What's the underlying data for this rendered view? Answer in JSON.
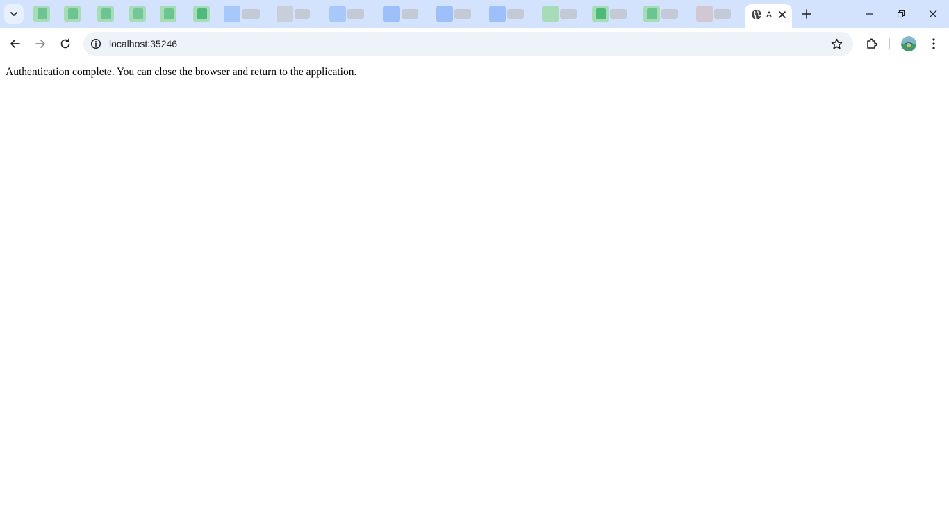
{
  "browser": {
    "active_tab": {
      "title": "A",
      "icon": "globe-icon"
    },
    "background_tabs_note_colors": {
      "green": "#6cc590",
      "blue": "#8ab4f8",
      "gray": "#b9bfca",
      "pink": "#d7c2cc"
    },
    "address_bar": {
      "url": "localhost:35246",
      "site_info_icon": "info-icon"
    },
    "icons": {
      "tab_search": "chevron-down-icon",
      "new_tab": "plus-icon",
      "minimize": "minimize-icon",
      "restore": "restore-icon",
      "close_window": "close-icon",
      "back": "arrow-left-icon",
      "forward": "arrow-right-icon",
      "reload": "reload-icon",
      "bookmark": "star-icon",
      "extensions": "puzzle-icon",
      "profile": "avatar",
      "menu": "kebab-menu-icon"
    }
  },
  "page": {
    "message": "Authentication complete. You can close the browser and return to the application."
  }
}
